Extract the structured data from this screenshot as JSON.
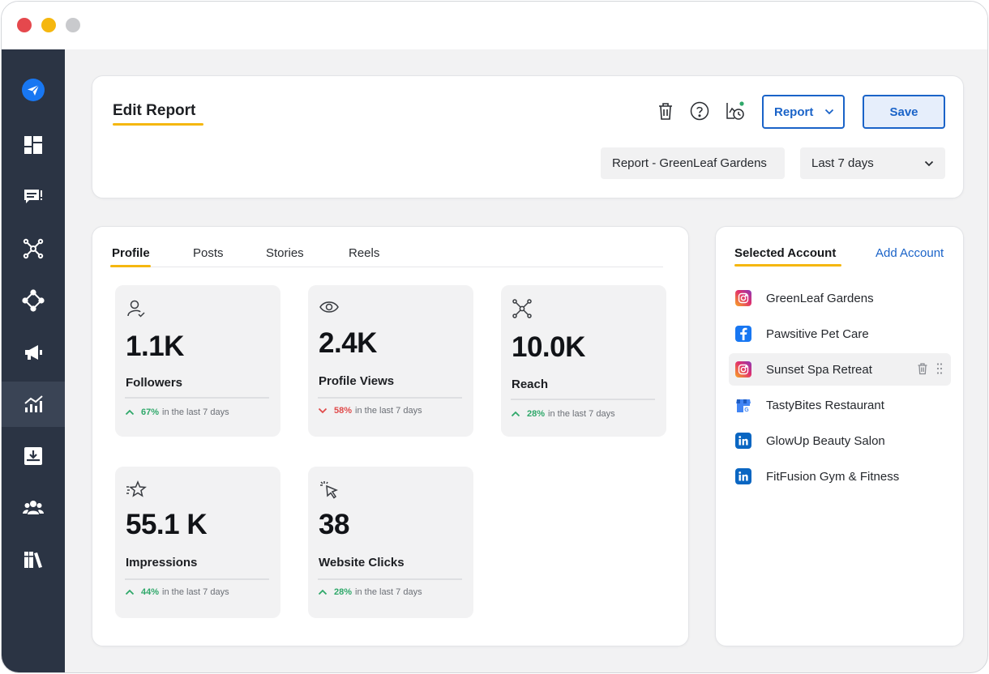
{
  "header": {
    "title": "Edit Report",
    "report_button": "Report",
    "save_button": "Save",
    "report_name": "Report - GreenLeaf Gardens",
    "date_range": "Last 7 days"
  },
  "tabs": [
    {
      "label": "Profile",
      "active": true
    },
    {
      "label": "Posts",
      "active": false
    },
    {
      "label": "Stories",
      "active": false
    },
    {
      "label": "Reels",
      "active": false
    }
  ],
  "metrics": [
    {
      "icon": "user-check-icon",
      "value": "1.1K",
      "label": "Followers",
      "trend": "up",
      "pct": "67%",
      "period": "in the last 7 days"
    },
    {
      "icon": "eye-icon",
      "value": "2.4K",
      "label": "Profile Views",
      "trend": "down",
      "pct": "58%",
      "period": "in the last 7 days"
    },
    {
      "icon": "network-icon",
      "value": "10.0K",
      "label": "Reach",
      "trend": "up",
      "pct": "28%",
      "period": "in the last 7 days"
    },
    {
      "icon": "sparkle-star-icon",
      "value": "55.1 K",
      "label": "Impressions",
      "trend": "up",
      "pct": "44%",
      "period": "in the last 7 days"
    },
    {
      "icon": "cursor-click-icon",
      "value": "38",
      "label": "Website Clicks",
      "trend": "up",
      "pct": "28%",
      "period": "in the last 7 days"
    }
  ],
  "accounts_panel": {
    "title": "Selected Account",
    "add_label": "Add Account",
    "accounts": [
      {
        "name": "GreenLeaf Gardens",
        "network": "instagram"
      },
      {
        "name": "Pawsitive Pet Care",
        "network": "facebook"
      },
      {
        "name": "Sunset Spa Retreat",
        "network": "instagram",
        "hovered": true
      },
      {
        "name": "TastyBites Restaurant",
        "network": "google-business"
      },
      {
        "name": "GlowUp Beauty Salon",
        "network": "linkedin"
      },
      {
        "name": "FitFusion Gym & Fitness",
        "network": "linkedin"
      }
    ]
  },
  "sidebar": {
    "items": [
      {
        "icon": "send-logo-icon"
      },
      {
        "icon": "dashboard-icon"
      },
      {
        "icon": "inbox-icon"
      },
      {
        "icon": "network-icon"
      },
      {
        "icon": "publish-icon"
      },
      {
        "icon": "megaphone-icon"
      },
      {
        "icon": "analytics-icon",
        "active": true
      },
      {
        "icon": "download-tray-icon"
      },
      {
        "icon": "team-icon"
      },
      {
        "icon": "library-icon"
      }
    ]
  },
  "colors": {
    "accent": "#1a63c8",
    "highlight": "#f5b70f",
    "sidebar": "#2b3444",
    "positive": "#2fa86a",
    "negative": "#e04b4b"
  }
}
